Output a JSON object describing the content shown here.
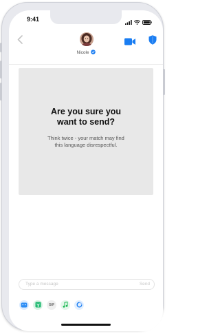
{
  "status_bar": {
    "time": "9:41"
  },
  "header": {
    "contact_name": "Nicole",
    "back_icon": "chevron-left-icon",
    "verified_icon": "verified-badge-icon",
    "video_icon": "video-camera-icon",
    "safety_icon": "shield-icon"
  },
  "modal": {
    "title_line1": "Are you sure you",
    "title_line2": "want to send?",
    "body_line1": "Think twice - your match may find",
    "body_line2": "this language disrespectful."
  },
  "composer": {
    "placeholder": "Type a message",
    "value": "",
    "send_label": "Send"
  },
  "toolbar": {
    "gif_label": "GIF",
    "items": [
      "sticker-icon",
      "gift-icon",
      "gif-icon",
      "music-icon",
      "loading-ring-icon"
    ]
  },
  "colors": {
    "accent_blue": "#1a7df2",
    "modal_bg": "#e8e8e8"
  }
}
